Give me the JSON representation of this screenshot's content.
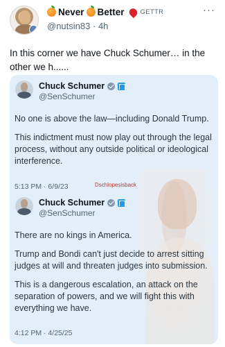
{
  "post": {
    "display_name_a": "Never",
    "display_name_b": "Better",
    "platform": "GETTR",
    "handle": "@nutsin83",
    "time": "4h",
    "more": "···",
    "text": "In this corner we have Chuck Schumer… in the other we h......"
  },
  "screenshot": {
    "watermark": "Dschlopesisback",
    "tweets": [
      {
        "name": "Chuck Schumer",
        "handle": "@SenSchumer",
        "paragraphs": [
          "No one is above the law—including Donald Trump.",
          "This indictment must now play out through the legal process, without any outside political or ideological interference."
        ],
        "timestamp": "5:13 PM · 6/9/23"
      },
      {
        "name": "Chuck Schumer",
        "handle": "@SenSchumer",
        "paragraphs": [
          "There are no kings in America.",
          "Trump and Bondi can't just decide to arrest sitting judges at will and threaten judges into submission.",
          "This is a dangerous escalation, an attack on the separation of powers, and we will fight this with everything we have."
        ],
        "timestamp": "4:12 PM · 4/25/25"
      }
    ]
  },
  "icons": {
    "orange": "orange-emoji-icon",
    "gettr": "gettr-logo-icon",
    "verified": "verified-badge-icon",
    "government": "government-badge-icon"
  },
  "colors": {
    "card_background": "#e2effb",
    "text": "#0f1419",
    "muted": "#536471",
    "watermark": "#c0392b"
  }
}
